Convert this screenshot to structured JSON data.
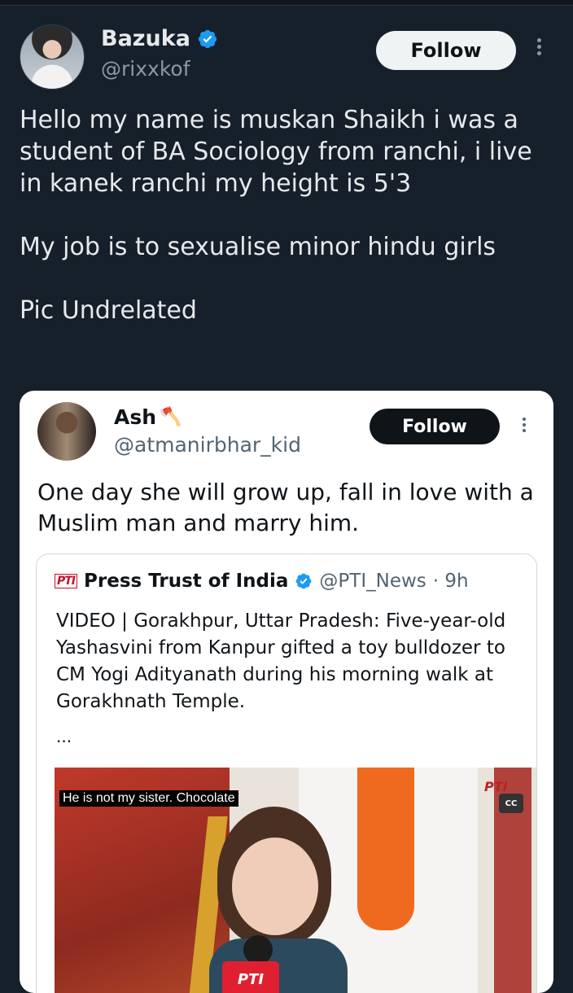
{
  "tweet": {
    "author_name": "Bazuka",
    "author_handle": "@rixxkof",
    "follow_label": "Follow",
    "paragraphs": [
      "Hello my name is muskan Shaikh i was a student of BA Sociology from ranchi, i live in kanek ranchi my height is 5'3",
      "My job is to sexualise minor hindu girls",
      "Pic Undrelated"
    ]
  },
  "embedded": {
    "author_name": "Ash",
    "author_emoji": "🪓",
    "author_handle": "@atmanirbhar_kid",
    "follow_label": "Follow",
    "text": "One day she will grow up, fall in love with a Muslim man and marry him.",
    "quote": {
      "logo_text": "PTI",
      "author_name": "Press Trust of India",
      "author_handle": "@PTI_News",
      "time": "· 9h",
      "text": "VIDEO | Gorakhpur, Uttar Pradesh: Five-year-old Yashasvini from Kanpur gifted a toy bulldozer to CM Yogi Adityanath during his morning walk at Gorakhnath Temple.",
      "ellipsis": "...",
      "media": {
        "subtitle": "He is not my sister. Chocolate",
        "cc_label": "CC",
        "watermark": "PTI",
        "mic_label": "PTI"
      }
    }
  },
  "colors": {
    "background": "#15202b",
    "verified": "#1d9bf0",
    "text_primary": "#e7e9ea",
    "text_secondary": "#8b98a5"
  }
}
